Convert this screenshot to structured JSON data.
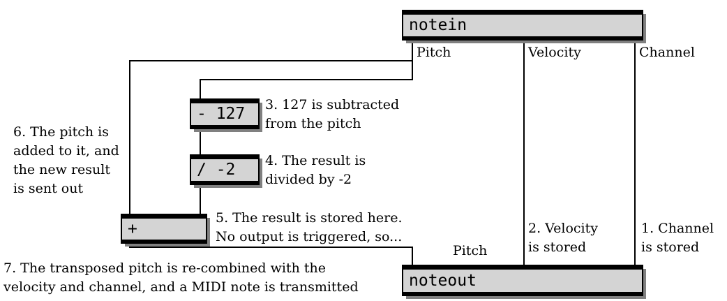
{
  "objects": {
    "notein": "notein",
    "minus": "- 127",
    "divide": "/ -2",
    "plus": "+",
    "noteout": "noteout"
  },
  "labels": {
    "notein_pitch": "Pitch",
    "notein_velocity": "Velocity",
    "notein_channel": "Channel",
    "noteout_pitch": "Pitch"
  },
  "comments": {
    "step1": [
      "1. Channel",
      "is stored"
    ],
    "step2": [
      "2. Velocity",
      "is stored"
    ],
    "step3": [
      "3. 127 is subtracted",
      "from the pitch"
    ],
    "step4": [
      "4. The result is",
      "divided by -2"
    ],
    "step5": [
      "5. The result is stored here.",
      "No output is triggered, so..."
    ],
    "step6": [
      "6. The pitch is",
      "added to it, and",
      "the new result",
      "is sent out"
    ],
    "step7": [
      "7. The transposed pitch is re-combined with the",
      "velocity and channel, and a MIDI note is transmitted"
    ]
  }
}
